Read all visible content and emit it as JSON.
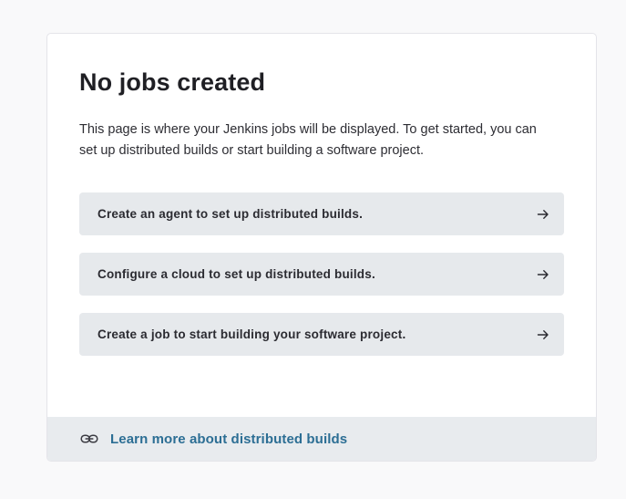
{
  "empty_state": {
    "title": "No jobs created",
    "description": "This page is where your Jenkins jobs will be displayed. To get started, you can set up distributed builds or start building a software project."
  },
  "actions": [
    {
      "label": "Create an agent to set up distributed builds.",
      "icon": "arrow-right-icon"
    },
    {
      "label": "Configure a cloud to set up distributed builds.",
      "icon": "arrow-right-icon"
    },
    {
      "label": "Create a job to start building your software project.",
      "icon": "arrow-right-icon"
    }
  ],
  "footer": {
    "link_label": "Learn more about distributed builds",
    "icon": "link-icon"
  },
  "colors": {
    "link": "#2c6e94",
    "action_bg": "#e6e9ec",
    "footer_bg": "#e8ebee"
  }
}
